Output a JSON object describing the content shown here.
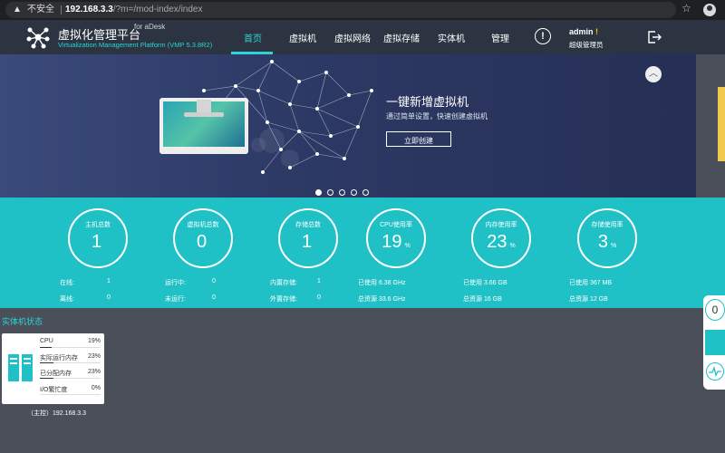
{
  "browser": {
    "security_label": "不安全",
    "url_host": "192.168.3.3",
    "url_path": "/?m=/mod-index/index"
  },
  "header": {
    "title": "虚拟化管理平台",
    "for_label": "for aDesk",
    "subtitle": "Virtualization Management Platform (VMP 5.3.8R2)",
    "nav": [
      {
        "label": "首页"
      },
      {
        "label": "虚拟机"
      },
      {
        "label": "虚拟网络"
      },
      {
        "label": "虚拟存储"
      },
      {
        "label": "实体机"
      },
      {
        "label": "管理"
      }
    ],
    "alert_glyph": "!",
    "user_name": "admin",
    "user_flag": "!",
    "user_role": "超级管理员"
  },
  "banner": {
    "title": "一键新增虚拟机",
    "desc": "通过简单设置，快速创建虚拟机",
    "button": "立即创建",
    "active_slide": 1,
    "slide_count": 5,
    "collapse_glyph": "︿"
  },
  "stats": [
    {
      "label": "主机总数",
      "value": "1",
      "unit": "",
      "rows": [
        {
          "k": "在线:",
          "v": "1"
        },
        {
          "k": "离线:",
          "v": "0"
        }
      ]
    },
    {
      "label": "虚拟机总数",
      "value": "0",
      "unit": "",
      "rows": [
        {
          "k": "运行中:",
          "v": "0"
        },
        {
          "k": "未运行:",
          "v": "0"
        }
      ]
    },
    {
      "label": "存储总数",
      "value": "1",
      "unit": "",
      "rows": [
        {
          "k": "内置存储:",
          "v": "1"
        },
        {
          "k": "外置存储:",
          "v": "0"
        }
      ]
    },
    {
      "label": "CPU使用率",
      "value": "19",
      "unit": "%",
      "rows": [
        {
          "full": "已使用 6.38 GHz"
        },
        {
          "full": "总资源 33.6 GHz"
        }
      ]
    },
    {
      "label": "内存使用率",
      "value": "23",
      "unit": "%",
      "rows": [
        {
          "full": "已使用 3.66 GB"
        },
        {
          "full": "总资源 16 GB"
        }
      ]
    },
    {
      "label": "存储使用率",
      "value": "3",
      "unit": "%",
      "rows": [
        {
          "full": "已使用 367 MB"
        },
        {
          "full": "总资源 12 GB"
        }
      ]
    }
  ],
  "physical": {
    "section_title": "实体机状态",
    "host_caption": "（主控）192.168.3.3",
    "metrics": [
      {
        "name": "CPU",
        "value": "19%",
        "fraction": 0.19
      },
      {
        "name": "实际运行内存",
        "value": "23%",
        "fraction": 0.23
      },
      {
        "name": "已分配内存",
        "value": "23%",
        "fraction": 0.23
      },
      {
        "name": "I/O繁忙度",
        "value": "0%",
        "fraction": 0.0
      }
    ]
  },
  "side_widget": {
    "count": "0"
  },
  "colors": {
    "accent": "#1fc1c6",
    "header_bg": "#2b3440",
    "warning": "#f5c400"
  }
}
